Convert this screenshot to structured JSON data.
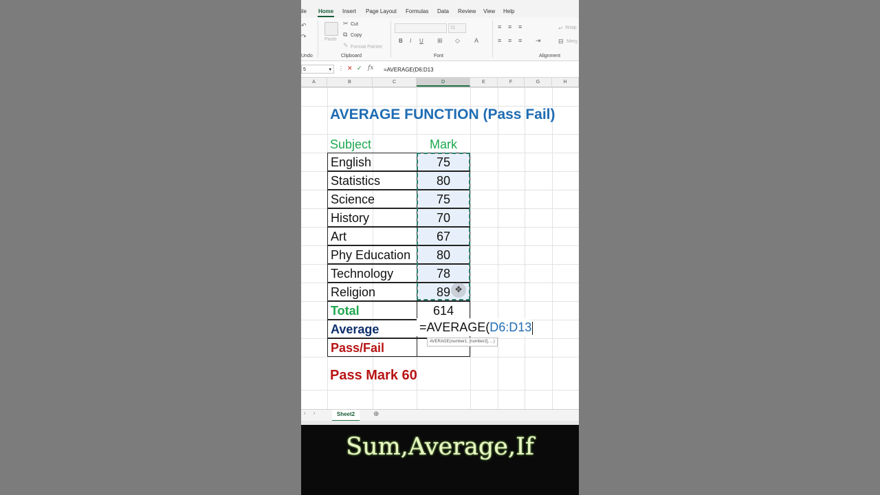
{
  "menu": [
    "ile",
    "Home",
    "Insert",
    "Page Layout",
    "Formulas",
    "Data",
    "Review",
    "View",
    "Help"
  ],
  "ribbon": {
    "paste": "Paste",
    "cut": "Cut",
    "copy": "Copy",
    "format_painter": "Format Painter",
    "font_size": "11",
    "wrap": "Wrap",
    "merge": "Merg",
    "groups": [
      "Undo",
      "Clipboard",
      "Font",
      "Alignment"
    ]
  },
  "formula_bar": {
    "name_box": "5",
    "formula": "=AVERAGE(D6:D13"
  },
  "columns": [
    "A",
    "B",
    "C",
    "D",
    "E",
    "F",
    "G",
    "H"
  ],
  "sheet": {
    "title": "AVERAGE FUNCTION (Pass Fail)",
    "headers": {
      "subject": "Subject",
      "mark": "Mark"
    },
    "rows": [
      {
        "subject": "English",
        "mark": "75"
      },
      {
        "subject": "Statistics",
        "mark": "80"
      },
      {
        "subject": "Science",
        "mark": "75"
      },
      {
        "subject": "History",
        "mark": "70"
      },
      {
        "subject": "Art",
        "mark": "67"
      },
      {
        "subject": "Phy Education",
        "mark": "80"
      },
      {
        "subject": "Technology",
        "mark": "78"
      },
      {
        "subject": "Religion",
        "mark": "89"
      }
    ],
    "total_label": "Total",
    "total_value": "614",
    "average_label": "Average",
    "edit_prefix": "=AVERAGE(",
    "edit_ref": "D6:D13",
    "tooltip": "AVERAGE(number1, [number2], ...)",
    "passfail_label": "Pass/Fail",
    "pass_mark": "Pass Mark 60"
  },
  "tabs": {
    "active": "Sheet2"
  },
  "caption": "Sum,Average,If"
}
